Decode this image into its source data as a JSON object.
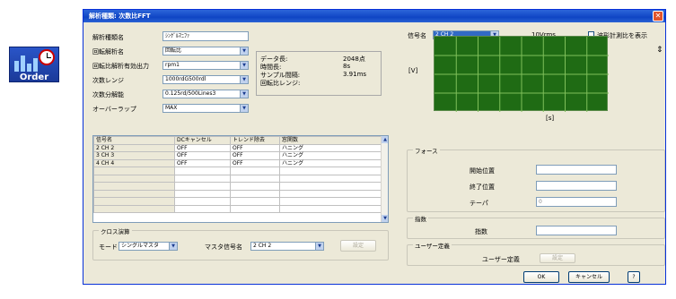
{
  "desktop_icon": {
    "label": "Order"
  },
  "dialog": {
    "title": "解析種類: 次数比FFT",
    "left": {
      "rows": [
        {
          "label": "解析種類名",
          "value": "ｼﾝｸﾞﾙﾏﾆﾌｧ",
          "type": "text"
        },
        {
          "label": "回転解析名",
          "value": "回転比",
          "type": "combo"
        },
        {
          "label": "回転比解析有効出力",
          "value": "rpm1",
          "type": "combo"
        },
        {
          "label": "次数レンジ",
          "value": "1000rdG500rdl",
          "type": "combo"
        },
        {
          "label": "次数分解能",
          "value": "0.125rd/500Lines3",
          "type": "combo"
        },
        {
          "label": "オーバーラップ",
          "value": "MAX",
          "type": "combo"
        }
      ],
      "info": {
        "labels": [
          "データ長:",
          "時間長:",
          "サンプル間隔:",
          "回転比レンジ:"
        ],
        "values": [
          "2048点",
          "8s",
          "3.91ms",
          ""
        ]
      }
    },
    "grid": {
      "headers": [
        "信号名",
        "DCキャンセル",
        "トレンド除去",
        "窓関数"
      ],
      "rows": [
        [
          "2 CH 2",
          "OFF",
          "OFF",
          "ハニング"
        ],
        [
          "3 CH 3",
          "OFF",
          "OFF",
          "ハニング"
        ],
        [
          "4 CH 4",
          "OFF",
          "OFF",
          "ハニング"
        ],
        [
          "",
          "",
          "",
          ""
        ],
        [
          "",
          "",
          "",
          ""
        ],
        [
          "",
          "",
          "",
          ""
        ],
        [
          "",
          "",
          "",
          ""
        ],
        [
          "",
          "",
          "",
          ""
        ],
        [
          "",
          "",
          "",
          ""
        ]
      ]
    },
    "cross": {
      "group_title": "クロス演算",
      "mode_label": "モード",
      "mode_value": "シングルマスタ",
      "master_label": "マスタ信号名",
      "master_value": "2 CH 2",
      "button": "設定"
    },
    "right": {
      "signal_label": "信号名",
      "signal_value": "2 CH 2",
      "value_text": "10Vrms",
      "checkbox_label": "波形計測比を表示",
      "chart_ylabel": "[V]",
      "chart_xlabel": "[s]",
      "force_group": "フォース",
      "start_label": "開始位置",
      "end_label": "終了位置",
      "taper_label": "テーパ",
      "taper_value": "0",
      "index_group": "指数",
      "index_label": "指数",
      "user_group": "ユーザー定義",
      "user_label": "ユーザー定義",
      "user_button": "設定"
    },
    "footer": {
      "ok": "OK",
      "cancel": "キャンセル",
      "help": "?"
    }
  },
  "colors": {
    "titlebar": "#0f45c4",
    "chart_bg": "#1f6b14",
    "chart_grid": "#7fbf5a"
  }
}
